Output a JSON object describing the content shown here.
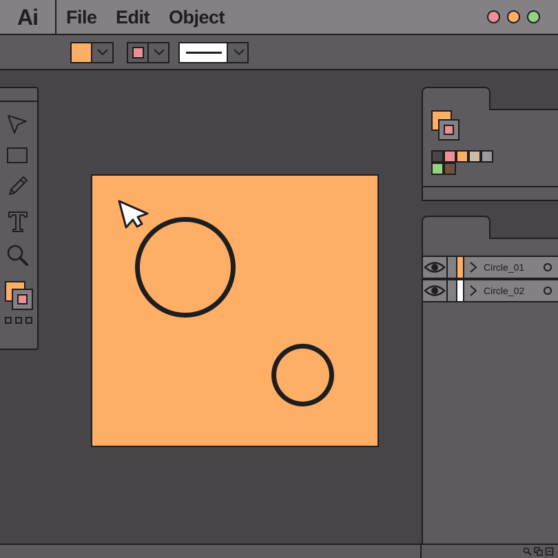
{
  "app": {
    "logo": "Ai"
  },
  "menu": [
    {
      "label": "File"
    },
    {
      "label": "Edit"
    },
    {
      "label": "Object"
    }
  ],
  "window_controls": {
    "close_color": "#ee8f95",
    "minimize_color": "#ffae66",
    "maximize_color": "#96d282"
  },
  "toolbar": {
    "fill_color": "#ffae66",
    "stroke_color": "#ee8f95",
    "stroke_style": "solid-line"
  },
  "tools": [
    {
      "name": "selection-tool",
      "icon": "arrow-pointer-icon"
    },
    {
      "name": "rectangle-tool",
      "icon": "rectangle-icon"
    },
    {
      "name": "pencil-tool",
      "icon": "pencil-icon"
    },
    {
      "name": "type-tool",
      "icon": "type-icon"
    },
    {
      "name": "zoom-tool",
      "icon": "magnifier-icon"
    }
  ],
  "colors": {
    "fill": "#ffae66",
    "stroke": "#ee8f95",
    "swatches": [
      "#474548",
      "#ee8f95",
      "#ffae66",
      "#cbbba6",
      "#9b999e",
      "#96d282",
      "#6e5140"
    ]
  },
  "artboard": {
    "fill": "#ffae66"
  },
  "layers": [
    {
      "name": "Circle_01",
      "color": "#ffae66"
    },
    {
      "name": "Circle_02",
      "color": "#ffffff"
    }
  ]
}
